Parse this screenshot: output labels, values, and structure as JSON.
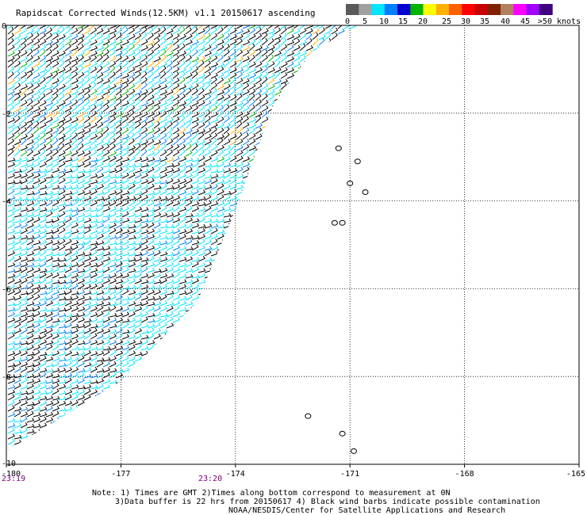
{
  "chart_data": {
    "type": "scatter",
    "title": "Rapidscat Corrected Winds(12.5KM) v1.1 20150617 ascending",
    "x_ticks": [
      "-180",
      "-177",
      "-174",
      "-171",
      "-168",
      "-165"
    ],
    "y_ticks": [
      "0",
      "-2",
      "-4",
      "-6",
      "-8",
      "-10"
    ],
    "xlim": [
      -180,
      -165
    ],
    "ylim": [
      -10,
      0
    ],
    "grid": true,
    "legend": {
      "placement": "top-right",
      "labels": [
        "0",
        "5",
        "10",
        "15",
        "20",
        "25",
        "30",
        "35",
        "40",
        "45",
        ">50 knots"
      ],
      "colors": [
        "#5a5a5a",
        "#a0a0a0",
        "#00e5ff",
        "#0080ff",
        "#0000d0",
        "#00b400",
        "#ffff00",
        "#ffb000",
        "#ff6000",
        "#ff0000",
        "#c80000",
        "#802000",
        "#b08060",
        "#ff00ff",
        "#a000ff",
        "#400080"
      ]
    },
    "swath_edge": [
      [
        -180,
        -9.7
      ],
      [
        -177,
        -8.1
      ],
      [
        -175,
        -6.3
      ],
      [
        -174.0,
        -4.2
      ],
      [
        -173,
        -1.8
      ],
      [
        -172,
        -0.6
      ],
      [
        -170.8,
        0
      ]
    ],
    "island_points": [
      [
        -171.3,
        -2.8
      ],
      [
        -170.8,
        -3.1
      ],
      [
        -171.0,
        -3.6
      ],
      [
        -170.6,
        -3.8
      ],
      [
        -171.4,
        -4.5
      ],
      [
        -171.2,
        -4.5
      ],
      [
        -171.2,
        -9.3
      ],
      [
        -170.9,
        -9.7
      ],
      [
        -172.1,
        -8.9
      ]
    ],
    "times": {
      "left": "23:19",
      "center": "23:20"
    }
  },
  "note": {
    "line1": "Note: 1) Times are GMT 2)Times along bottom correspond to measurement at 0N",
    "line2": "3)Data buffer is 22 hrs from 20150617 4) Black wind barbs indicate possible contamination",
    "line3": "NOAA/NESDIS/Center for Satellite Applications and Research"
  }
}
